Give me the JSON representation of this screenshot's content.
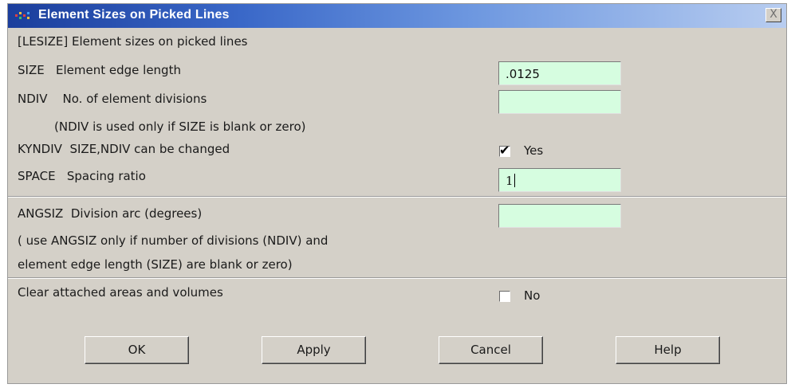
{
  "window": {
    "title": "Element Sizes on Picked Lines",
    "close_label": "X"
  },
  "header": {
    "text": "[LESIZE]  Element sizes on picked lines"
  },
  "rows": {
    "size": {
      "key": "SIZE",
      "label": "Element edge length",
      "value": ".0125"
    },
    "ndiv": {
      "key": "NDIV",
      "label": "No. of element divisions",
      "value": ""
    },
    "ndiv_note": "(NDIV is used only if SIZE is blank or zero)",
    "kyndiv": {
      "key": "KYNDIV",
      "label": "SIZE,NDIV can be changed",
      "checked": true,
      "check_label": "Yes"
    },
    "space": {
      "key": "SPACE",
      "label": "Spacing ratio",
      "value": "1"
    },
    "angsiz": {
      "key": "ANGSIZ",
      "label": "Division arc (degrees)",
      "value": ""
    },
    "angsiz_note_1": "( use ANGSIZ only if number of divisions (NDIV) and",
    "angsiz_note_2": "element edge length (SIZE) are blank or zero)",
    "clear": {
      "label": "Clear attached areas and volumes",
      "checked": false,
      "check_label": "No"
    }
  },
  "buttons": {
    "ok": "OK",
    "apply": "Apply",
    "cancel": "Cancel",
    "help": "Help"
  },
  "colors": {
    "titlebar_start": "#1b3e9c",
    "titlebar_end": "#b8cdf0",
    "field_bg": "#d6fde0",
    "dialog_bg": "#d4d0c8"
  }
}
